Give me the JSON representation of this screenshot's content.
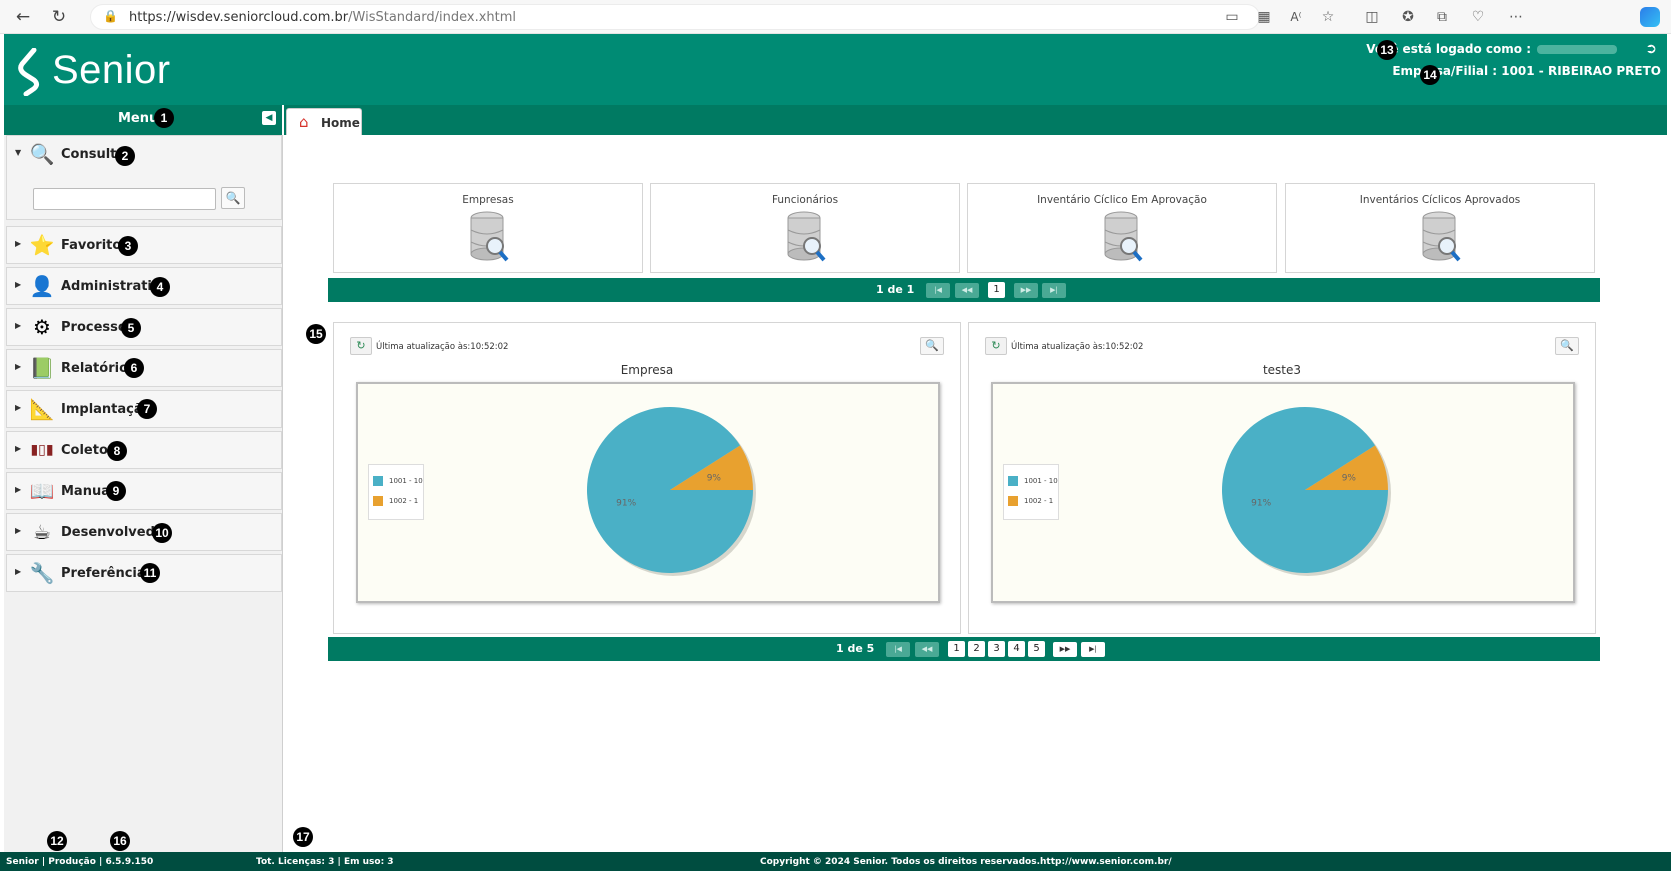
{
  "browser": {
    "url_base": "https://wisdev.seniorcloud.com.br",
    "url_path": "/WisStandard/index.xhtml"
  },
  "header": {
    "logo_text": "Senior",
    "user_label": "Você está logado como :",
    "company_label": "Empresa/Filial : 1001 - RIBEIRAO PRETO"
  },
  "menu": {
    "title": "Menu",
    "items": [
      {
        "label": "Consulta",
        "icon": "search-window-icon"
      },
      {
        "label": "Favoritos",
        "icon": "folder-star-icon"
      },
      {
        "label": "Administrativo",
        "icon": "user-icon"
      },
      {
        "label": "Processos",
        "icon": "gears-icon"
      },
      {
        "label": "Relatórios",
        "icon": "report-book-icon"
      },
      {
        "label": "Implantação",
        "icon": "design-tools-icon"
      },
      {
        "label": "Coletor",
        "icon": "barcode-icon"
      },
      {
        "label": "Manual",
        "icon": "book-icon"
      },
      {
        "label": "Desenvolvedor",
        "icon": "coffee-cup-icon"
      },
      {
        "label": "Preferências",
        "icon": "wrench-globe-icon"
      }
    ]
  },
  "tabs": {
    "home": "Home"
  },
  "cards": [
    {
      "title": "Empresas"
    },
    {
      "title": "Funcionários"
    },
    {
      "title": "Inventário Cíclico Em Aprovação"
    },
    {
      "title": "Inventários Cíclicos Aprovados"
    }
  ],
  "pager1": {
    "text": "1 de 1",
    "pages": [
      "1"
    ]
  },
  "charts": [
    {
      "update_label": "Última atualização às:10:52:02",
      "title": "Empresa",
      "chart_data": {
        "type": "pie",
        "title": "Empresa",
        "labels": [
          "1001 - 10",
          "1002 - 1"
        ],
        "values": [
          91,
          9
        ],
        "value_labels": [
          "91%",
          "9%"
        ],
        "colors": [
          "#4ab0c6",
          "#e8a12f"
        ],
        "legend": "left"
      }
    },
    {
      "update_label": "Última atualização às:10:52:02",
      "title": "teste3",
      "chart_data": {
        "type": "pie",
        "title": "teste3",
        "labels": [
          "1001 - 10",
          "1002 - 1"
        ],
        "values": [
          91,
          9
        ],
        "value_labels": [
          "91%",
          "9%"
        ],
        "colors": [
          "#4ab0c6",
          "#e8a12f"
        ],
        "legend": "left"
      }
    }
  ],
  "pager2": {
    "text": "1 de 5",
    "pages": [
      "1",
      "2",
      "3",
      "4",
      "5"
    ]
  },
  "footer": {
    "version": "Senior | Produção | 6.5.9.150",
    "licenses": "Tot. Licenças: 3 | Em uso: 3",
    "copyright": "Copyright © 2024 Senior. Todos os direitos reservados.http://www.senior.com.br/"
  },
  "markers": [
    "1",
    "2",
    "3",
    "4",
    "5",
    "6",
    "7",
    "8",
    "9",
    "10",
    "11",
    "12",
    "13",
    "14",
    "15",
    "16",
    "17"
  ],
  "colors": {
    "primary": "#008b74",
    "dark": "#007a62",
    "footer": "#004d40"
  }
}
